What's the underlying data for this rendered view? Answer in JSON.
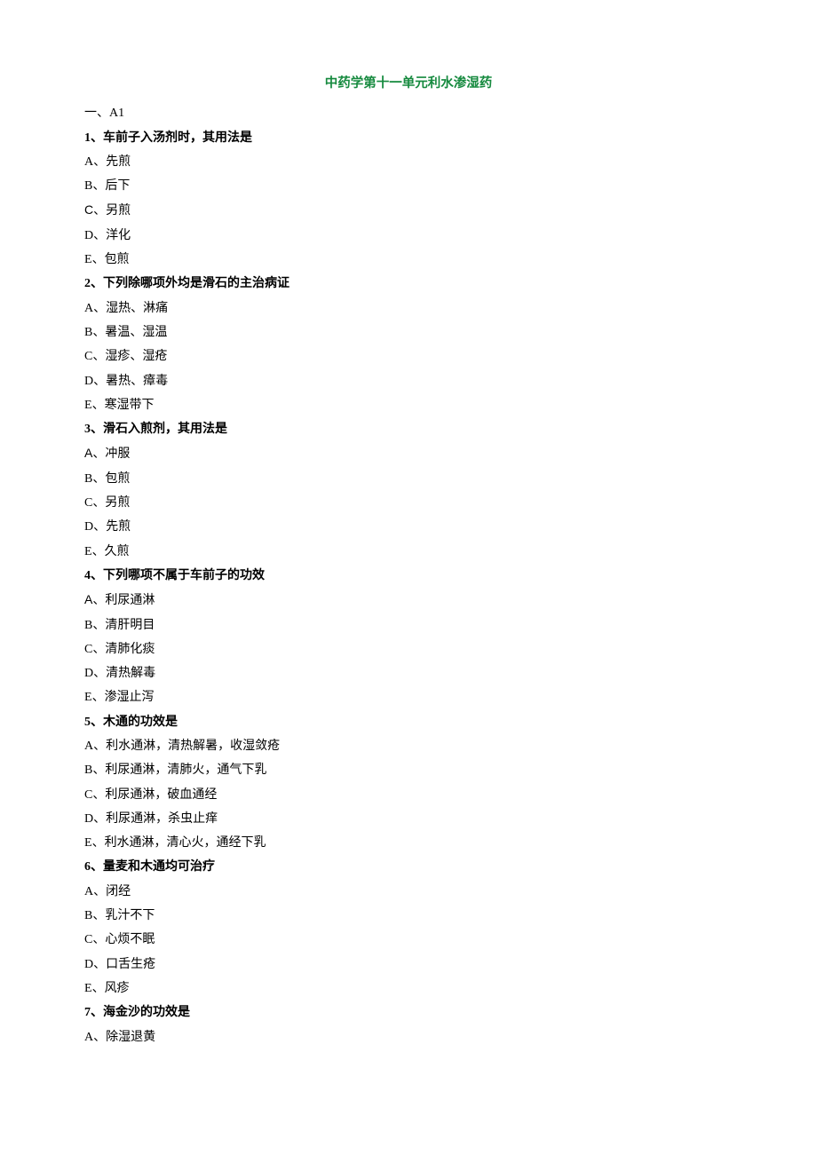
{
  "title": "中药学第十一单元利水渗湿药",
  "section_heading": "一、A1",
  "questions": [
    {
      "num": "1",
      "stem": "车前子入汤剂时，其用法是",
      "options": [
        {
          "letter": "A",
          "letter_sans": false,
          "text": "先煎"
        },
        {
          "letter": "B",
          "letter_sans": false,
          "text": "后下"
        },
        {
          "letter": "C",
          "letter_sans": true,
          "text": "另煎"
        },
        {
          "letter": "D",
          "letter_sans": false,
          "text": "洋化"
        },
        {
          "letter": "E",
          "letter_sans": false,
          "text": "包煎"
        }
      ]
    },
    {
      "num": "2",
      "stem": "下列除哪项外均是滑石的主治病证",
      "options": [
        {
          "letter": "A",
          "letter_sans": false,
          "text": "湿热、淋痛"
        },
        {
          "letter": "B",
          "letter_sans": false,
          "text": "暑温、湿温"
        },
        {
          "letter": "C",
          "letter_sans": false,
          "text": "湿疹、湿疮"
        },
        {
          "letter": "D",
          "letter_sans": false,
          "text": "暑热、瘴毒"
        },
        {
          "letter": "E",
          "letter_sans": false,
          "text": "寒湿带下"
        }
      ]
    },
    {
      "num": "3",
      "stem": "滑石入煎剂，其用法是",
      "options": [
        {
          "letter": "A",
          "letter_sans": true,
          "text": "冲服"
        },
        {
          "letter": "B",
          "letter_sans": false,
          "text": "包煎"
        },
        {
          "letter": "C",
          "letter_sans": false,
          "text": "另煎"
        },
        {
          "letter": "D",
          "letter_sans": false,
          "text": "先煎"
        },
        {
          "letter": "E",
          "letter_sans": false,
          "text": "久煎"
        }
      ]
    },
    {
      "num": "4",
      "stem": "下列哪项不属于车前子的功效",
      "options": [
        {
          "letter": "A",
          "letter_sans": true,
          "text": "利尿通淋"
        },
        {
          "letter": "B",
          "letter_sans": false,
          "text": "清肝明目"
        },
        {
          "letter": "C",
          "letter_sans": false,
          "text": "清肺化痰"
        },
        {
          "letter": "D",
          "letter_sans": false,
          "text": "清热解毒"
        },
        {
          "letter": "E",
          "letter_sans": false,
          "text": "渗湿止泻"
        }
      ]
    },
    {
      "num": "5",
      "stem": "木通的功效是",
      "options": [
        {
          "letter": "A",
          "letter_sans": false,
          "text": "利水通淋，清热解暑，收湿敛疮"
        },
        {
          "letter": "B",
          "letter_sans": false,
          "text": "利尿通淋，清肺火，通气下乳"
        },
        {
          "letter": "C",
          "letter_sans": false,
          "text": "利尿通淋，破血通经"
        },
        {
          "letter": "D",
          "letter_sans": false,
          "text": "利尿通淋，杀虫止痒"
        },
        {
          "letter": "E",
          "letter_sans": false,
          "text": "利水通淋，清心火，通经下乳"
        }
      ]
    },
    {
      "num": "6",
      "stem": "量麦和木通均可治疗",
      "options": [
        {
          "letter": "A",
          "letter_sans": false,
          "text": "闭经"
        },
        {
          "letter": "B",
          "letter_sans": false,
          "text": "乳汁不下"
        },
        {
          "letter": "C",
          "letter_sans": false,
          "text": "心烦不眠"
        },
        {
          "letter": "D",
          "letter_sans": false,
          "text": "口舌生疮"
        },
        {
          "letter": "E",
          "letter_sans": false,
          "text": "风疹"
        }
      ]
    },
    {
      "num": "7",
      "stem": "海金沙的功效是",
      "options": [
        {
          "letter": "A",
          "letter_sans": false,
          "text": "除湿退黄"
        }
      ]
    }
  ]
}
